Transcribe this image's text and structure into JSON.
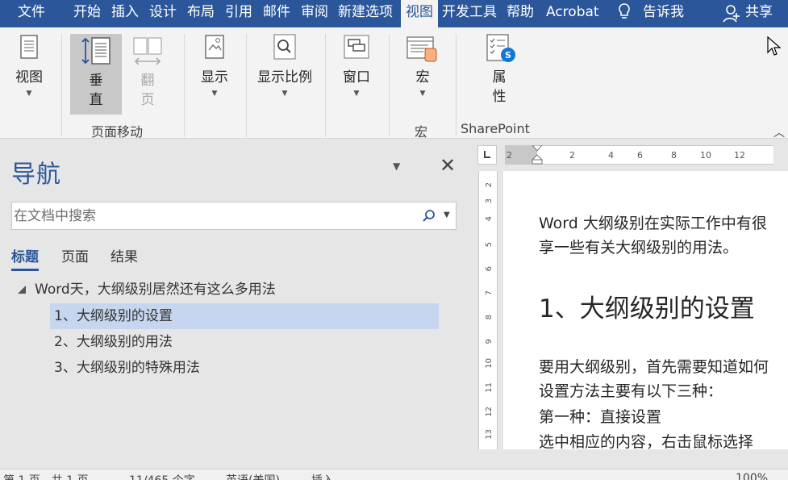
{
  "menu": {
    "tabs": [
      "文件",
      "开始",
      "插入",
      "设计",
      "布局",
      "引用",
      "邮件",
      "审阅",
      "新建选项",
      "视图",
      "开发工具",
      "帮助",
      "Acrobat"
    ],
    "active_tab": "视图",
    "tell_me": "告诉我",
    "share": "共享"
  },
  "ribbon": {
    "buttons": {
      "view": "视图",
      "vertical_1": "垂",
      "vertical_2": "直",
      "flip_1": "翻",
      "flip_2": "页",
      "show": "显示",
      "zoom": "显示比例",
      "window": "窗口",
      "macros": "宏",
      "props_1": "属",
      "props_2": "性"
    },
    "groups": {
      "page_movement": "页面移动",
      "macros": "宏",
      "sharepoint": "SharePoint"
    }
  },
  "nav": {
    "title": "导航",
    "search_placeholder": "在文档中搜索",
    "tabs": [
      "标题",
      "页面",
      "结果"
    ],
    "active_tab": "标题",
    "headings": [
      "Word天，大纲级别居然还有这么多用法",
      "1、大纲级别的设置",
      "2、大纲级别的用法",
      "3、大纲级别的特殊用法"
    ],
    "selected_index": 1
  },
  "ruler": {
    "h_numbers": [
      "2",
      "2",
      "4",
      "6",
      "8",
      "10",
      "12"
    ],
    "v_numbers": [
      "2",
      "3",
      "4",
      "5",
      "6",
      "7",
      "8",
      "9",
      "10",
      "11",
      "12",
      "13",
      "14"
    ]
  },
  "document": {
    "line1": "Word 大纲级别在实际工作中有很",
    "line2": "享一些有关大纲级别的用法。",
    "heading": "1、大纲级别的设置",
    "line3": "要用大纲级别，首先需要知道如何",
    "line4": "设置方法主要有以下三种：",
    "line5": "第一种：直接设置",
    "line6": "选中相应的内容，右击鼠标选择"
  },
  "status": {
    "page": "第 1 页，共 1 页",
    "words": "11/465 个字",
    "lang": "英语(美国)",
    "mode": "插入",
    "zoom": "100%"
  },
  "colors": {
    "accent": "#2b579a",
    "selection": "#c5d6ee"
  }
}
